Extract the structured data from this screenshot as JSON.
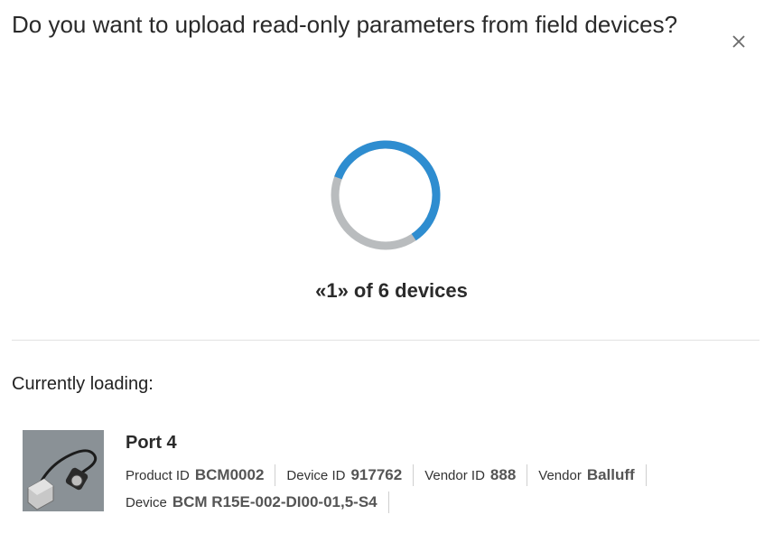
{
  "dialog": {
    "title": "Do you want to upload read-only parameters from field devices?",
    "close_icon": "close-icon"
  },
  "progress": {
    "text": "«1» of 6 devices",
    "current": 1,
    "total": 6,
    "fraction": 0.6,
    "colors": {
      "active": "#2e8dd0",
      "track": "#b9bcbe"
    }
  },
  "loading": {
    "label": "Currently loading:",
    "device": {
      "port": "Port 4",
      "image": "sensor-cable-image",
      "props": [
        {
          "label": "Product ID",
          "value": "BCM0002"
        },
        {
          "label": "Device ID",
          "value": "917762"
        },
        {
          "label": "Vendor ID",
          "value": "888"
        },
        {
          "label": "Vendor",
          "value": "Balluff"
        },
        {
          "label": "Device",
          "value": "BCM R15E-002-DI00-01,5-S4"
        }
      ]
    }
  }
}
